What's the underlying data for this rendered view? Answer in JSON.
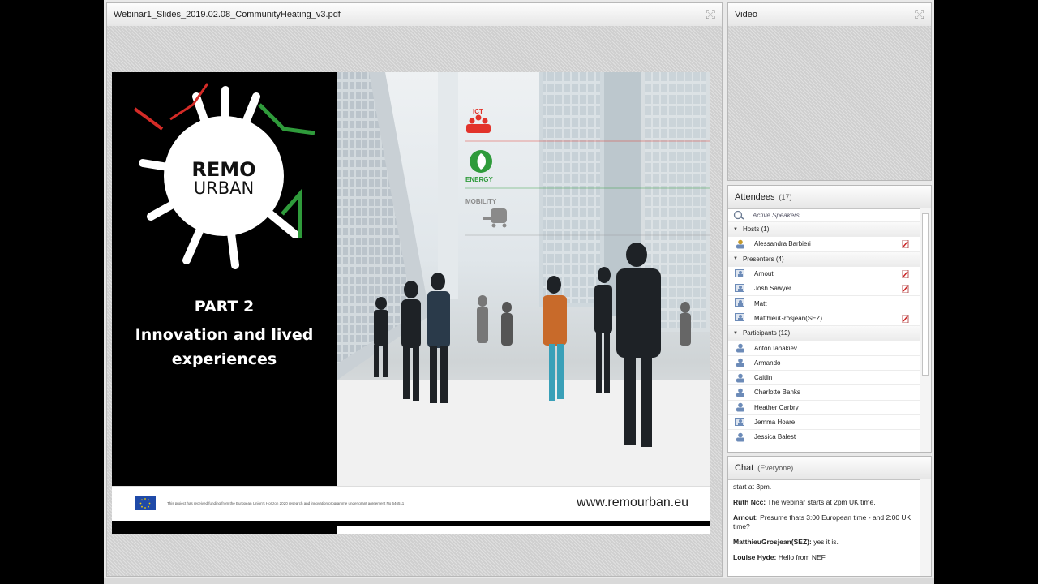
{
  "share": {
    "title": "Webinar1_Slides_2019.02.08_CommunityHeating_v3.pdf",
    "slide": {
      "logo_line1": "REMO",
      "logo_line2": "URBAN",
      "part": "PART 2",
      "heading_line1": "Innovation and lived",
      "heading_line2": "experiences",
      "tag_ict": "ICT",
      "tag_energy": "ENERGY",
      "tag_mobility": "MOBILITY",
      "footer_small": "This project has received funding from the European Union's Horizon 2020 research and innovation programme under grant agreement No 646511",
      "url": "www.remourban.eu"
    }
  },
  "video": {
    "title": "Video"
  },
  "attendees": {
    "title": "Attendees",
    "count": "(17)",
    "active_speakers": "Active Speakers",
    "groups": [
      {
        "label": "Hosts (1)",
        "people": [
          "Alessandra Barbieri"
        ]
      },
      {
        "label": "Presenters (4)",
        "people": [
          "Arnout",
          "Josh Sawyer",
          "Matt",
          "MatthieuGrosjean(SEZ)"
        ]
      },
      {
        "label": "Participants (12)",
        "people": [
          "Anton Ianakiev",
          "Armando",
          "Caitlin",
          "Charlotte Banks",
          "Heather Carbry",
          "Jemma Hoare",
          "Jessica Balest"
        ]
      }
    ]
  },
  "chat": {
    "title": "Chat",
    "scope": "(Everyone)",
    "messages": [
      {
        "author": "",
        "text": "start at 3pm."
      },
      {
        "author": "Ruth Ncc:",
        "text": "The webinar starts at 2pm UK time."
      },
      {
        "author": "Arnout:",
        "text": "Presume thats 3:00 European time - and 2:00 UK time?"
      },
      {
        "author": "MatthieuGrosjean(SEZ):",
        "text": "yes it is."
      },
      {
        "author": "Louise Hyde:",
        "text": "Hello from NEF"
      }
    ]
  },
  "colors": {
    "pod_bg": "#e9e9e9",
    "ict_red": "#e2332b",
    "energy_green": "#2f9b3b",
    "mobility_gray": "#8a8a8a"
  }
}
